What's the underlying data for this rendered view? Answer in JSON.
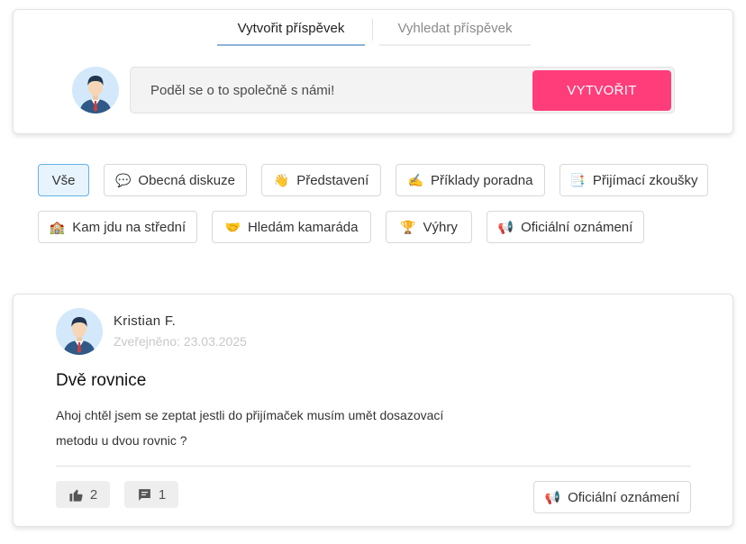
{
  "tabs": {
    "create_label": "Vytvořit příspěvek",
    "search_label": "Vyhledat příspěvek"
  },
  "composer": {
    "placeholder": "Poděl se o to společně s námi!",
    "create_button": "VYTVOŘIT"
  },
  "filters": [
    {
      "label": "Vše",
      "icon": "",
      "selected": true
    },
    {
      "label": "Obecná diskuze",
      "icon": "💬"
    },
    {
      "label": "Představení",
      "icon": "👋"
    },
    {
      "label": "Příklady poradna",
      "icon": "✍️"
    },
    {
      "label": "Přijímací zkoušky",
      "icon": "📑"
    },
    {
      "label": "Kam jdu na střední",
      "icon": "🏫"
    },
    {
      "label": "Hledám kamaráda",
      "icon": "🤝"
    },
    {
      "label": "Výhry",
      "icon": "🏆"
    },
    {
      "label": "Oficiální oznámení",
      "icon": "📢"
    }
  ],
  "post": {
    "author": "Kristian F.",
    "date": "Zveřejněno: 23.03.2025",
    "title": "Dvě rovnice",
    "body_line1": "Ahoj chtěl jsem se zeptat jestli do přijímaček musím umět dosazovací",
    "body_line2": "metodu u dvou rovnic ?",
    "likes": "2",
    "comments": "1",
    "category_icon": "📢",
    "category": "Oficiální oznámení"
  },
  "colors": {
    "accent": "#ff3d7a",
    "selected_chip_bg": "#e8f4fd",
    "selected_chip_border": "#5fb3e8"
  }
}
